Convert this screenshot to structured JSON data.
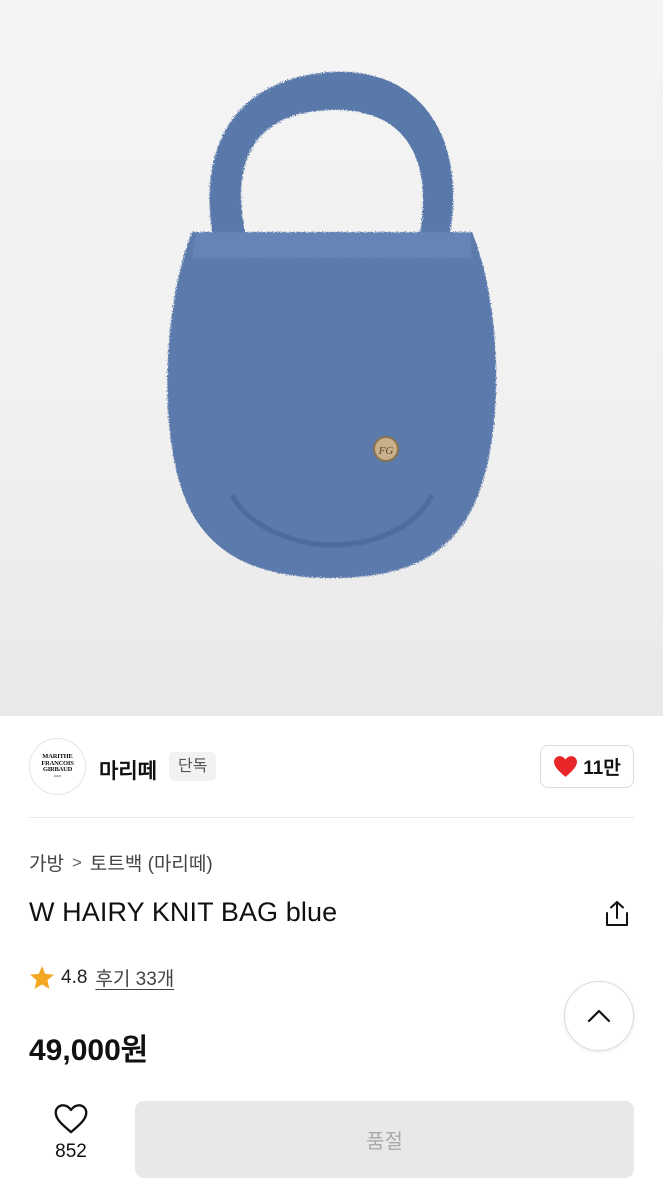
{
  "product_image": {
    "logo_mark": "FG"
  },
  "brand": {
    "logo_lines": [
      "MARITHE",
      "FRANCOIS",
      "GIRBAUD"
    ],
    "logo_small": "PARIS",
    "name": "마리떼",
    "badge": "단독",
    "like_count": "11만",
    "heart_color": "#e8262a"
  },
  "breadcrumb": {
    "category": "가방",
    "separator": ">",
    "subcategory": "토트백 (마리떼)"
  },
  "product": {
    "title": "W HAIRY KNIT BAG blue",
    "rating": "4.8",
    "reviews_label": "후기 33개",
    "price": "49,000원",
    "star_color": "#f5a623"
  },
  "bottom_bar": {
    "wish_count": "852",
    "soldout_label": "품절"
  }
}
